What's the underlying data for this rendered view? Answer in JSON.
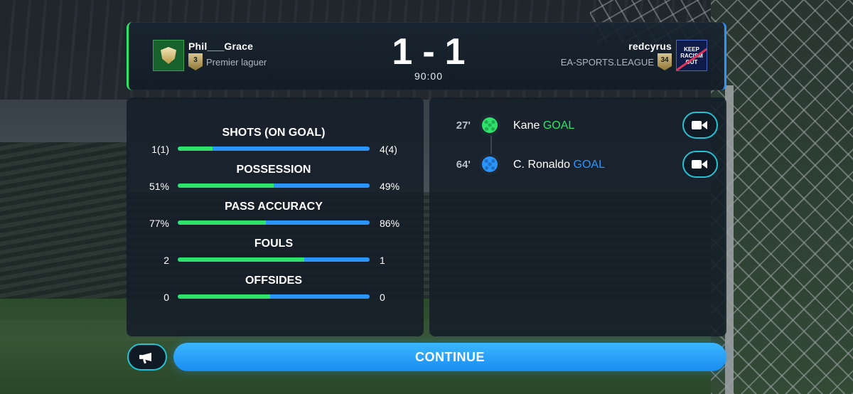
{
  "colors": {
    "home": "#2de36a",
    "away": "#2b95ff",
    "accent_outline": "#25c1d4"
  },
  "match": {
    "home": {
      "name": "Phil___Grace",
      "league": "Premier laguer",
      "level": "3",
      "crest_icon": "gold-shield-crest-icon"
    },
    "away": {
      "name": "redcyrus",
      "league": "EA-SPORTS.LEAGUE",
      "level": "34",
      "crest_icon": "keep-racism-out-crest-icon",
      "crest_text": "KEEP RACISM OUT"
    },
    "home_score": "1",
    "separator": "-",
    "away_score": "1",
    "clock": "90:00"
  },
  "stats": [
    {
      "label": "SHOTS (ON GOAL)",
      "home": "1(1)",
      "away": "4(4)",
      "home_share": 0.18
    },
    {
      "label": "POSSESSION",
      "home": "51%",
      "away": "49%",
      "home_share": 0.5
    },
    {
      "label": "PASS ACCURACY",
      "home": "77%",
      "away": "86%",
      "home_share": 0.46
    },
    {
      "label": "FOULS",
      "home": "2",
      "away": "1",
      "home_share": 0.66
    },
    {
      "label": "OFFSIDES",
      "home": "0",
      "away": "0",
      "home_share": 0.48
    }
  ],
  "events": [
    {
      "minute": "27'",
      "player": "Kane",
      "type": "GOAL",
      "team": "home",
      "icon": "football-icon",
      "replay_icon": "video-camera-icon"
    },
    {
      "minute": "64'",
      "player": "C. Ronaldo",
      "type": "GOAL",
      "team": "away",
      "icon": "football-icon",
      "replay_icon": "video-camera-icon"
    }
  ],
  "footer": {
    "chat_icon": "megaphone-icon",
    "continue_label": "CONTINUE"
  }
}
